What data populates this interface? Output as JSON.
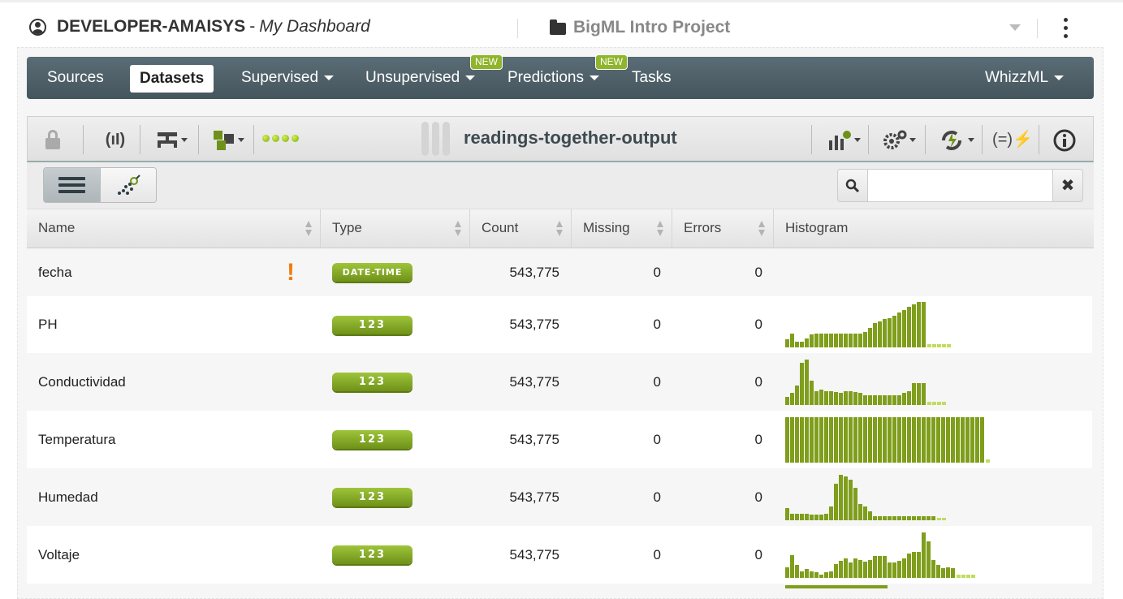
{
  "header": {
    "org_name": "DEVELOPER-AMAISYS",
    "separator": "-",
    "dashboard_label": "My Dashboard",
    "project_name": "BigML Intro Project"
  },
  "nav": {
    "items": [
      {
        "label": "Sources",
        "dropdown": false
      },
      {
        "label": "Datasets",
        "dropdown": false,
        "active": true
      },
      {
        "label": "Supervised",
        "dropdown": true
      },
      {
        "label": "Unsupervised",
        "dropdown": true,
        "badge": "NEW"
      },
      {
        "label": "Predictions",
        "dropdown": true,
        "badge": "NEW"
      },
      {
        "label": "Tasks",
        "dropdown": false
      },
      {
        "label": "WhizzML",
        "dropdown": true
      }
    ]
  },
  "toolbar": {
    "dataset_name": "readings-together-output",
    "icons": [
      "lock-icon",
      "sample-icon",
      "model-icon",
      "configure-icon",
      "status-dots-icon",
      "dataset-icon",
      "charts-icon",
      "settings-icon",
      "actions-icon",
      "formula-icon",
      "info-icon"
    ],
    "accent": "#8fb52c"
  },
  "view": {
    "search_placeholder": "",
    "search_value": ""
  },
  "table": {
    "columns": [
      "Name",
      "Type",
      "Count",
      "Missing",
      "Errors",
      "Histogram"
    ],
    "rows": [
      {
        "name": "fecha",
        "type": "DATE-TIME",
        "count": "543,775",
        "missing": "0",
        "errors": "0",
        "warning": "!",
        "histogram": [],
        "histogram_missing": []
      },
      {
        "name": "PH",
        "type": "123",
        "count": "543,775",
        "missing": "0",
        "errors": "0",
        "histogram": [
          0.18,
          0.3,
          0.12,
          0.12,
          0.2,
          0.28,
          0.3,
          0.3,
          0.3,
          0.3,
          0.3,
          0.3,
          0.3,
          0.3,
          0.3,
          0.3,
          0.34,
          0.42,
          0.54,
          0.58,
          0.62,
          0.64,
          0.7,
          0.76,
          0.82,
          0.9,
          0.94,
          1.0,
          1.0
        ],
        "histogram_missing": [
          0.08,
          0.08,
          0.08,
          0.08,
          0.08
        ]
      },
      {
        "name": "Conductividad",
        "type": "123",
        "count": "543,775",
        "missing": "0",
        "errors": "0",
        "histogram": [
          0.18,
          0.26,
          0.42,
          0.92,
          1.0,
          0.54,
          0.3,
          0.34,
          0.3,
          0.3,
          0.28,
          0.26,
          0.3,
          0.3,
          0.28,
          0.26,
          0.22,
          0.22,
          0.22,
          0.22,
          0.22,
          0.22,
          0.22,
          0.22,
          0.26,
          0.3,
          0.48,
          0.48,
          0.48
        ],
        "histogram_missing": [
          0.08,
          0.08,
          0.08,
          0.08
        ]
      },
      {
        "name": "Temperatura",
        "type": "123",
        "count": "543,775",
        "missing": "0",
        "errors": "0",
        "histogram": [
          1,
          1,
          1,
          1,
          1,
          1,
          1,
          1,
          1,
          1,
          1,
          1,
          1,
          1,
          1,
          1,
          1,
          1,
          1,
          1,
          1,
          1,
          1,
          1,
          1,
          1,
          1,
          1,
          1,
          1,
          1,
          1,
          1,
          1,
          1,
          1,
          1,
          1,
          1,
          1,
          1
        ],
        "histogram_missing": [
          0.08
        ]
      },
      {
        "name": "Humedad",
        "type": "123",
        "count": "543,775",
        "missing": "0",
        "errors": "0",
        "histogram": [
          0.26,
          0.14,
          0.14,
          0.14,
          0.14,
          0.12,
          0.12,
          0.12,
          0.14,
          0.3,
          0.8,
          1.0,
          0.96,
          0.9,
          0.72,
          0.36,
          0.3,
          0.2,
          0.09,
          0.09,
          0.09,
          0.09,
          0.09,
          0.09,
          0.09,
          0.09,
          0.09,
          0.09,
          0.09,
          0.09,
          0.09
        ],
        "histogram_missing": [
          0.06,
          0.06
        ]
      },
      {
        "name": "Voltaje",
        "type": "123",
        "count": "543,775",
        "missing": "0",
        "errors": "0",
        "histogram": [
          0.24,
          0.5,
          0.28,
          0.14,
          0.2,
          0.14,
          0.12,
          0.08,
          0.12,
          0.14,
          0.3,
          0.38,
          0.42,
          0.34,
          0.42,
          0.4,
          0.36,
          0.4,
          0.48,
          0.48,
          0.48,
          0.34,
          0.34,
          0.38,
          0.42,
          0.54,
          0.58,
          0.58,
          1.0,
          0.8,
          0.4,
          0.28,
          0.22,
          0.24,
          0.22
        ],
        "histogram_missing": [
          0.08,
          0.08,
          0.08,
          0.08
        ]
      }
    ]
  }
}
